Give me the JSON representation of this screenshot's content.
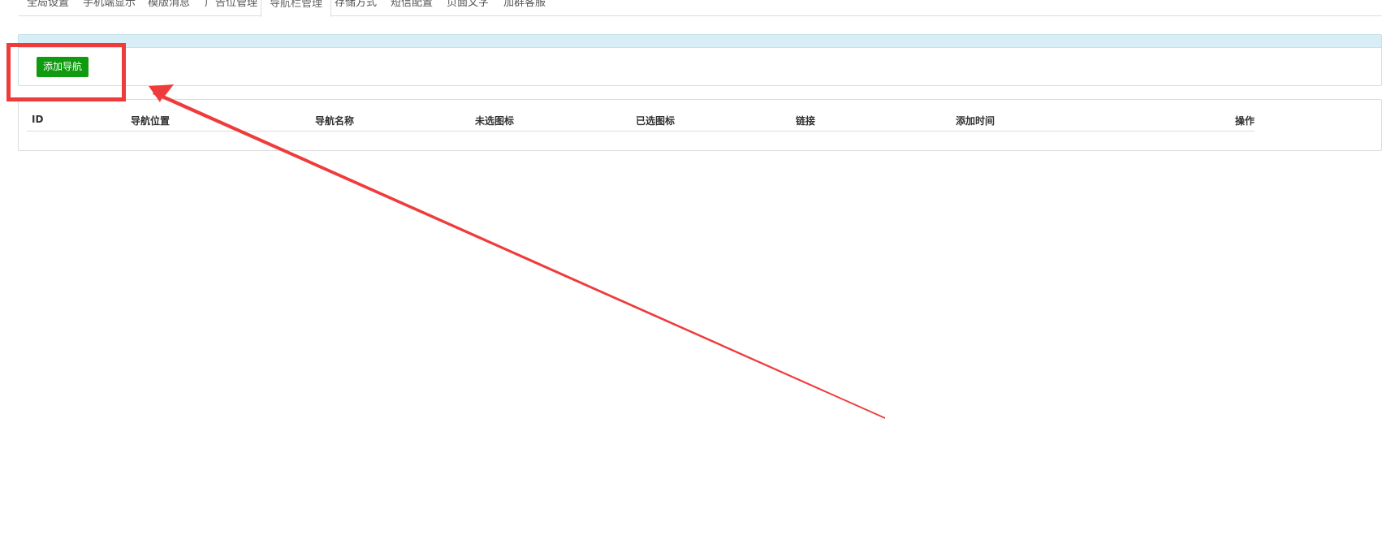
{
  "tabs": [
    {
      "label": "全局设置"
    },
    {
      "label": "手机端显示"
    },
    {
      "label": "模版消息"
    },
    {
      "label": "广告位管理"
    },
    {
      "label": "导航栏管理",
      "active": true
    },
    {
      "label": "存储方式"
    },
    {
      "label": "短信配置"
    },
    {
      "label": "页面文字"
    },
    {
      "label": "加群客服"
    }
  ],
  "toolbar": {
    "add_button_label": "添加导航",
    "add_button_color": "#0f9a0f"
  },
  "table": {
    "columns": [
      "ID",
      "导航位置",
      "导航名称",
      "未选图标",
      "已选图标",
      "链接",
      "添加时间",
      "操作"
    ],
    "rows": []
  },
  "annotation": {
    "color": "#ef3b3b"
  }
}
